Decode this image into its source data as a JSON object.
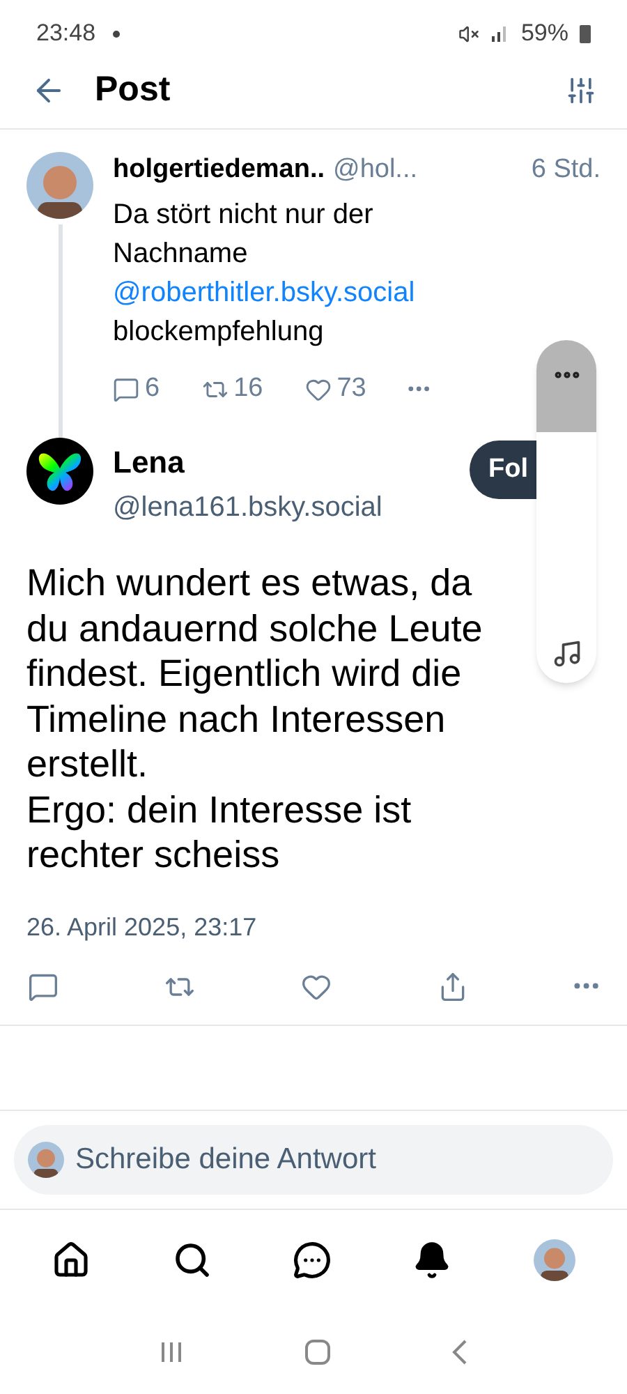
{
  "status_bar": {
    "time": "23:48",
    "battery": "59%"
  },
  "header": {
    "title": "Post"
  },
  "parent_post": {
    "display_name": "holgertiedeman..",
    "handle": "@hol...",
    "time": "6 Std.",
    "text_parts": [
      {
        "kind": "text",
        "text": "Da stört nicht nur der Nachname "
      },
      {
        "kind": "link",
        "text": "@roberthitler.bsky"
      },
      {
        "kind": "link",
        "text": ".social"
      },
      {
        "kind": "text",
        "text": " blockempfehlung"
      }
    ],
    "replies": "6",
    "reposts": "16",
    "likes": "73"
  },
  "main_post": {
    "display_name": "Lena",
    "handle": "@lena161.bsky.social",
    "follow_label": "Fol",
    "text_lines": [
      "Mich wundert es etwas, da",
      "du andauernd solche Leute",
      "findest. Eigentlich wird die",
      "Timeline nach Interessen",
      "erstellt.",
      "Ergo: dein Interesse ist",
      "rechter scheiss"
    ],
    "date": "26. April 2025, 23:17"
  },
  "reply_field": {
    "placeholder": "Schreibe deine Antwort"
  },
  "bottom_nav": [
    {
      "kind": "home"
    },
    {
      "kind": "search"
    },
    {
      "kind": "chat"
    },
    {
      "kind": "bell"
    },
    {
      "kind": "avatar"
    }
  ]
}
